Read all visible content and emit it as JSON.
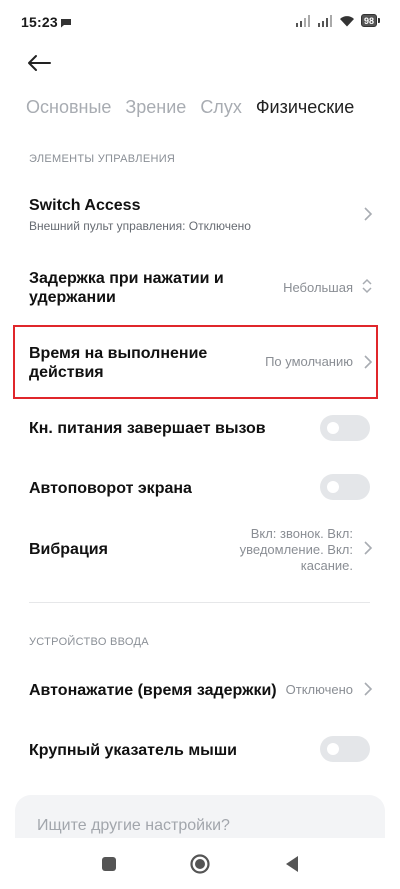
{
  "status_bar": {
    "time": "15:23",
    "battery": "98"
  },
  "tabs": [
    {
      "label": "Основные",
      "active": false
    },
    {
      "label": "Зрение",
      "active": false
    },
    {
      "label": "Слух",
      "active": false
    },
    {
      "label": "Физические",
      "active": true
    }
  ],
  "sections": {
    "controls_header": "ЭЛЕМЕНТЫ УПРАВЛЕНИЯ",
    "input_header": "УСТРОЙСТВО ВВОДА"
  },
  "rows": {
    "switch_access": {
      "title": "Switch Access",
      "subtitle": "Внешний пульт управления: Отключено"
    },
    "touch_delay": {
      "title_line1": "Задержка при нажатии и",
      "title_line2": "удержании",
      "value": "Небольшая"
    },
    "action_time": {
      "title_line1": "Время на выполнение",
      "title_line2": "действия",
      "value": "По умолчанию"
    },
    "power_ends_call": {
      "title": "Кн. питания завершает вызов",
      "enabled": false
    },
    "autorotate": {
      "title": "Автоповорот экрана",
      "enabled": false
    },
    "vibration": {
      "title": "Вибрация",
      "value_line1": "Вкл: звонок. Вкл:",
      "value_line2": "уведомление. Вкл:",
      "value_line3": "касание."
    },
    "autoclick": {
      "title": "Автонажатие (время задержки)",
      "value": "Отключено"
    },
    "large_pointer": {
      "title": "Крупный указатель мыши",
      "enabled": false
    }
  },
  "search": {
    "placeholder": "Ищите другие настройки?"
  },
  "colors": {
    "highlight": "#e0262b",
    "toggle_off": "#e4e6e9"
  }
}
